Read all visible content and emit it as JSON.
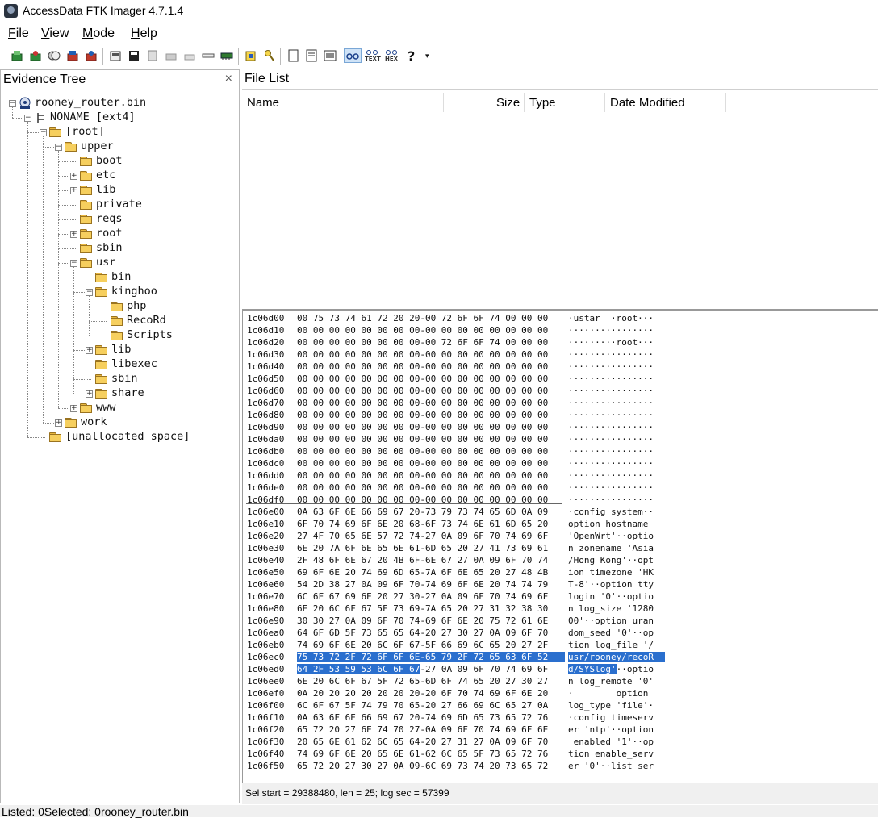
{
  "window": {
    "title": "AccessData FTK Imager 4.7.1.4"
  },
  "menu": [
    {
      "label": "File",
      "accel": "F",
      "rest": "ile"
    },
    {
      "label": "View",
      "accel": "V",
      "rest": "iew"
    },
    {
      "label": "Mode",
      "accel": "M",
      "rest": "ode"
    },
    {
      "label": "Help",
      "accel": "H",
      "rest": "elp"
    }
  ],
  "toolbar": {
    "text_view": "TEXT",
    "hex_view": "HEX",
    "help": "?"
  },
  "evidence_tree": {
    "title": "Evidence Tree",
    "close": "×",
    "items": [
      {
        "label": "rooney_router.bin"
      },
      {
        "label": "NONAME [ext4]"
      },
      {
        "label": "[root]"
      },
      {
        "label": "upper"
      },
      {
        "label": "boot"
      },
      {
        "label": "etc"
      },
      {
        "label": "lib"
      },
      {
        "label": "private"
      },
      {
        "label": "reqs"
      },
      {
        "label": "root"
      },
      {
        "label": "sbin"
      },
      {
        "label": "usr"
      },
      {
        "label": "bin"
      },
      {
        "label": "kinghoo"
      },
      {
        "label": "php"
      },
      {
        "label": "RecoRd"
      },
      {
        "label": "Scripts"
      },
      {
        "label": "lib"
      },
      {
        "label": "libexec"
      },
      {
        "label": "sbin"
      },
      {
        "label": "share"
      },
      {
        "label": "www"
      },
      {
        "label": "work"
      },
      {
        "label": "[unallocated space]"
      }
    ]
  },
  "file_list": {
    "title": "File List",
    "columns": [
      "Name",
      "Size",
      "Type",
      "Date Modified"
    ]
  },
  "hex_view": {
    "lines": [
      {
        "addr": "1c06d00",
        "hex": "00 75 73 74 61 72 20 20-00 72 6F 6F 74 00 00 00",
        "ascii": "·ustar  ·root···"
      },
      {
        "addr": "1c06d10",
        "hex": "00 00 00 00 00 00 00 00-00 00 00 00 00 00 00 00",
        "ascii": "················"
      },
      {
        "addr": "1c06d20",
        "hex": "00 00 00 00 00 00 00 00-00 72 6F 6F 74 00 00 00",
        "ascii": "·········root···"
      },
      {
        "addr": "1c06d30",
        "hex": "00 00 00 00 00 00 00 00-00 00 00 00 00 00 00 00",
        "ascii": "················"
      },
      {
        "addr": "1c06d40",
        "hex": "00 00 00 00 00 00 00 00-00 00 00 00 00 00 00 00",
        "ascii": "················"
      },
      {
        "addr": "1c06d50",
        "hex": "00 00 00 00 00 00 00 00-00 00 00 00 00 00 00 00",
        "ascii": "················"
      },
      {
        "addr": "1c06d60",
        "hex": "00 00 00 00 00 00 00 00-00 00 00 00 00 00 00 00",
        "ascii": "················"
      },
      {
        "addr": "1c06d70",
        "hex": "00 00 00 00 00 00 00 00-00 00 00 00 00 00 00 00",
        "ascii": "················"
      },
      {
        "addr": "1c06d80",
        "hex": "00 00 00 00 00 00 00 00-00 00 00 00 00 00 00 00",
        "ascii": "················"
      },
      {
        "addr": "1c06d90",
        "hex": "00 00 00 00 00 00 00 00-00 00 00 00 00 00 00 00",
        "ascii": "················"
      },
      {
        "addr": "1c06da0",
        "hex": "00 00 00 00 00 00 00 00-00 00 00 00 00 00 00 00",
        "ascii": "················"
      },
      {
        "addr": "1c06db0",
        "hex": "00 00 00 00 00 00 00 00-00 00 00 00 00 00 00 00",
        "ascii": "················"
      },
      {
        "addr": "1c06dc0",
        "hex": "00 00 00 00 00 00 00 00-00 00 00 00 00 00 00 00",
        "ascii": "················"
      },
      {
        "addr": "1c06dd0",
        "hex": "00 00 00 00 00 00 00 00-00 00 00 00 00 00 00 00",
        "ascii": "················"
      },
      {
        "addr": "1c06de0",
        "hex": "00 00 00 00 00 00 00 00-00 00 00 00 00 00 00 00",
        "ascii": "················"
      },
      {
        "addr": "1c06df0",
        "hex": "00 00 00 00 00 00 00 00-00 00 00 00 00 00 00 00",
        "ascii": "················"
      },
      {
        "addr": "1c06e00",
        "hex": "0A 63 6F 6E 66 69 67 20-73 79 73 74 65 6D 0A 09",
        "ascii": "·config system··"
      },
      {
        "addr": "1c06e10",
        "hex": "6F 70 74 69 6F 6E 20 68-6F 73 74 6E 61 6D 65 20",
        "ascii": "option hostname "
      },
      {
        "addr": "1c06e20",
        "hex": "27 4F 70 65 6E 57 72 74-27 0A 09 6F 70 74 69 6F",
        "ascii": "'OpenWrt'··optio"
      },
      {
        "addr": "1c06e30",
        "hex": "6E 20 7A 6F 6E 65 6E 61-6D 65 20 27 41 73 69 61",
        "ascii": "n zonename 'Asia"
      },
      {
        "addr": "1c06e40",
        "hex": "2F 48 6F 6E 67 20 4B 6F-6E 67 27 0A 09 6F 70 74",
        "ascii": "/Hong Kong'··opt"
      },
      {
        "addr": "1c06e50",
        "hex": "69 6F 6E 20 74 69 6D 65-7A 6F 6E 65 20 27 48 4B",
        "ascii": "ion timezone 'HK"
      },
      {
        "addr": "1c06e60",
        "hex": "54 2D 38 27 0A 09 6F 70-74 69 6F 6E 20 74 74 79",
        "ascii": "T-8'··option tty"
      },
      {
        "addr": "1c06e70",
        "hex": "6C 6F 67 69 6E 20 27 30-27 0A 09 6F 70 74 69 6F",
        "ascii": "login '0'··optio"
      },
      {
        "addr": "1c06e80",
        "hex": "6E 20 6C 6F 67 5F 73 69-7A 65 20 27 31 32 38 30",
        "ascii": "n log_size '1280"
      },
      {
        "addr": "1c06e90",
        "hex": "30 30 27 0A 09 6F 70 74-69 6F 6E 20 75 72 61 6E",
        "ascii": "00'··option uran"
      },
      {
        "addr": "1c06ea0",
        "hex": "64 6F 6D 5F 73 65 65 64-20 27 30 27 0A 09 6F 70",
        "ascii": "dom_seed '0'··op"
      },
      {
        "addr": "1c06eb0",
        "hex": "74 69 6F 6E 20 6C 6F 67-5F 66 69 6C 65 20 27 2F",
        "ascii": "tion log_file '/"
      },
      {
        "addr": "1c06ec0",
        "hex": "75 73 72 2F 72 6F 6F 6E-65 79 2F 72 65 63 6F 52",
        "ascii": "usr/rooney/recoR",
        "hl": "full"
      },
      {
        "addr": "1c06ed0",
        "hex": "64 2F 53 59 53 6C 6F 67-27 0A 09 6F 70 74 69 6F",
        "ascii": "d/SYSlog'··optio",
        "hl": "partial"
      },
      {
        "addr": "1c06ee0",
        "hex": "6E 20 6C 6F 67 5F 72 65-6D 6F 74 65 20 27 30 27",
        "ascii": "n log_remote '0'"
      },
      {
        "addr": "1c06ef0",
        "hex": "0A 20 20 20 20 20 20 20-20 6F 70 74 69 6F 6E 20",
        "ascii": "·        option "
      },
      {
        "addr": "1c06f00",
        "hex": "6C 6F 67 5F 74 79 70 65-20 27 66 69 6C 65 27 0A",
        "ascii": "log_type 'file'·"
      },
      {
        "addr": "1c06f10",
        "hex": "0A 63 6F 6E 66 69 67 20-74 69 6D 65 73 65 72 76",
        "ascii": "·config timeserv"
      },
      {
        "addr": "1c06f20",
        "hex": "65 72 20 27 6E 74 70 27-0A 09 6F 70 74 69 6F 6E",
        "ascii": "er 'ntp'··option"
      },
      {
        "addr": "1c06f30",
        "hex": "20 65 6E 61 62 6C 65 64-20 27 31 27 0A 09 6F 70",
        "ascii": " enabled '1'··op"
      },
      {
        "addr": "1c06f40",
        "hex": "74 69 6F 6E 20 65 6E 61-62 6C 65 5F 73 65 72 76",
        "ascii": "tion enable_serv"
      },
      {
        "addr": "1c06f50",
        "hex": "65 72 20 27 30 27 0A 09-6C 69 73 74 20 73 65 72",
        "ascii": "er '0'··list ser"
      }
    ],
    "selection_status": "Sel start = 29388480, len = 25; log sec = 57399"
  },
  "statusbar": {
    "text": "Listed: 0Selected: 0rooney_router.bin"
  }
}
